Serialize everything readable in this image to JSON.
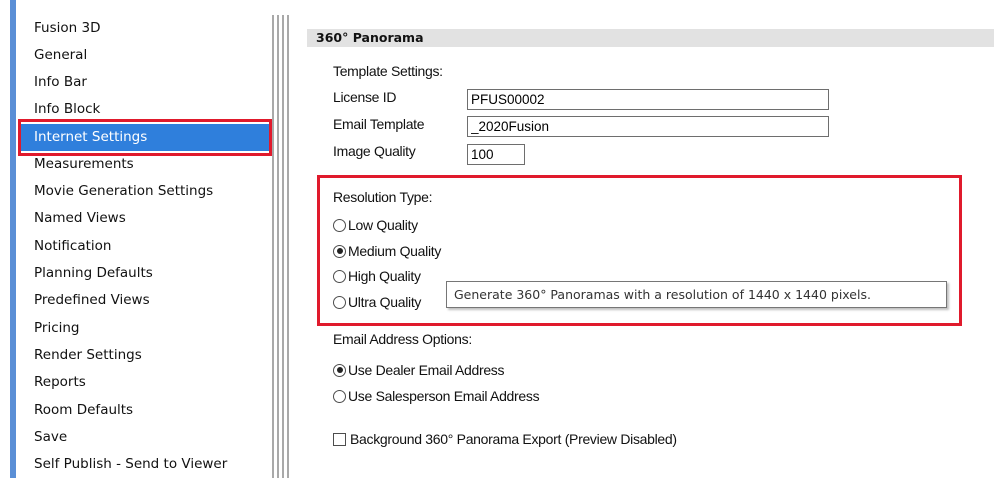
{
  "sidebar": {
    "items": [
      {
        "label": "Fusion 3D"
      },
      {
        "label": "General"
      },
      {
        "label": "Info Bar"
      },
      {
        "label": "Info Block"
      },
      {
        "label": "Internet Settings",
        "selected": true
      },
      {
        "label": "Measurements"
      },
      {
        "label": "Movie Generation Settings"
      },
      {
        "label": "Named Views"
      },
      {
        "label": "Notification"
      },
      {
        "label": "Planning Defaults"
      },
      {
        "label": "Predefined Views"
      },
      {
        "label": "Pricing"
      },
      {
        "label": "Render Settings"
      },
      {
        "label": "Reports"
      },
      {
        "label": "Room Defaults"
      },
      {
        "label": "Save"
      },
      {
        "label": "Self Publish - Send to Viewer"
      }
    ]
  },
  "panel": {
    "title": "360° Panorama",
    "template_settings": {
      "heading": "Template Settings:",
      "license_label": "License ID",
      "license_value": "PFUS00002",
      "email_template_label": "Email Template",
      "email_template_value": "_2020Fusion",
      "image_quality_label": "Image Quality",
      "image_quality_value": "100"
    },
    "resolution": {
      "heading": "Resolution Type:",
      "options": [
        {
          "label": "Low Quality",
          "checked": false
        },
        {
          "label": "Medium Quality",
          "checked": true
        },
        {
          "label": "High Quality",
          "checked": false
        },
        {
          "label": "Ultra Quality",
          "checked": false
        }
      ],
      "tooltip": "Generate 360° Panoramas with a resolution of 1440 x 1440 pixels."
    },
    "email_options": {
      "heading": "Email Address Options:",
      "options": [
        {
          "label": "Use Dealer Email Address",
          "checked": true
        },
        {
          "label": "Use Salesperson Email Address",
          "checked": false
        }
      ]
    },
    "background_export": {
      "label": "Background 360° Panorama Export (Preview Disabled)",
      "checked": false
    }
  },
  "colors": {
    "selection": "#2f7fdc",
    "highlight_frame": "#e01a2c",
    "header_bg": "#e2e2e2"
  }
}
